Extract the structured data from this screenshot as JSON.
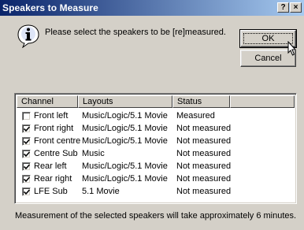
{
  "window": {
    "title": "Speakers to Measure",
    "help_button": "?",
    "close_button": "×"
  },
  "prompt": "Please select the speakers to be [re]measured.",
  "buttons": {
    "ok": "OK",
    "cancel": "Cancel"
  },
  "table": {
    "headers": [
      "Channel",
      "Layouts",
      "Status"
    ],
    "rows": [
      {
        "channel": "Front left",
        "layouts": "Music/Logic/5.1 Movie",
        "status": "Measured",
        "checked": false
      },
      {
        "channel": "Front right",
        "layouts": "Music/Logic/5.1 Movie",
        "status": "Not measured",
        "checked": true
      },
      {
        "channel": "Front centre",
        "layouts": "Music/Logic/5.1 Movie",
        "status": "Not measured",
        "checked": true
      },
      {
        "channel": "Centre Sub",
        "layouts": "Music",
        "status": "Not measured",
        "checked": true
      },
      {
        "channel": "Rear left",
        "layouts": "Music/Logic/5.1 Movie",
        "status": "Not measured",
        "checked": true
      },
      {
        "channel": "Rear right",
        "layouts": "Music/Logic/5.1 Movie",
        "status": "Not measured",
        "checked": true
      },
      {
        "channel": "LFE Sub",
        "layouts": "5.1 Movie",
        "status": "Not measured",
        "checked": true
      }
    ]
  },
  "footer": "Measurement of the selected speakers will take approximately 6 minutes.",
  "colors": {
    "titlebar_start": "#0a246a",
    "titlebar_end": "#a6caf0",
    "dialog_bg": "#d4d0c8"
  }
}
